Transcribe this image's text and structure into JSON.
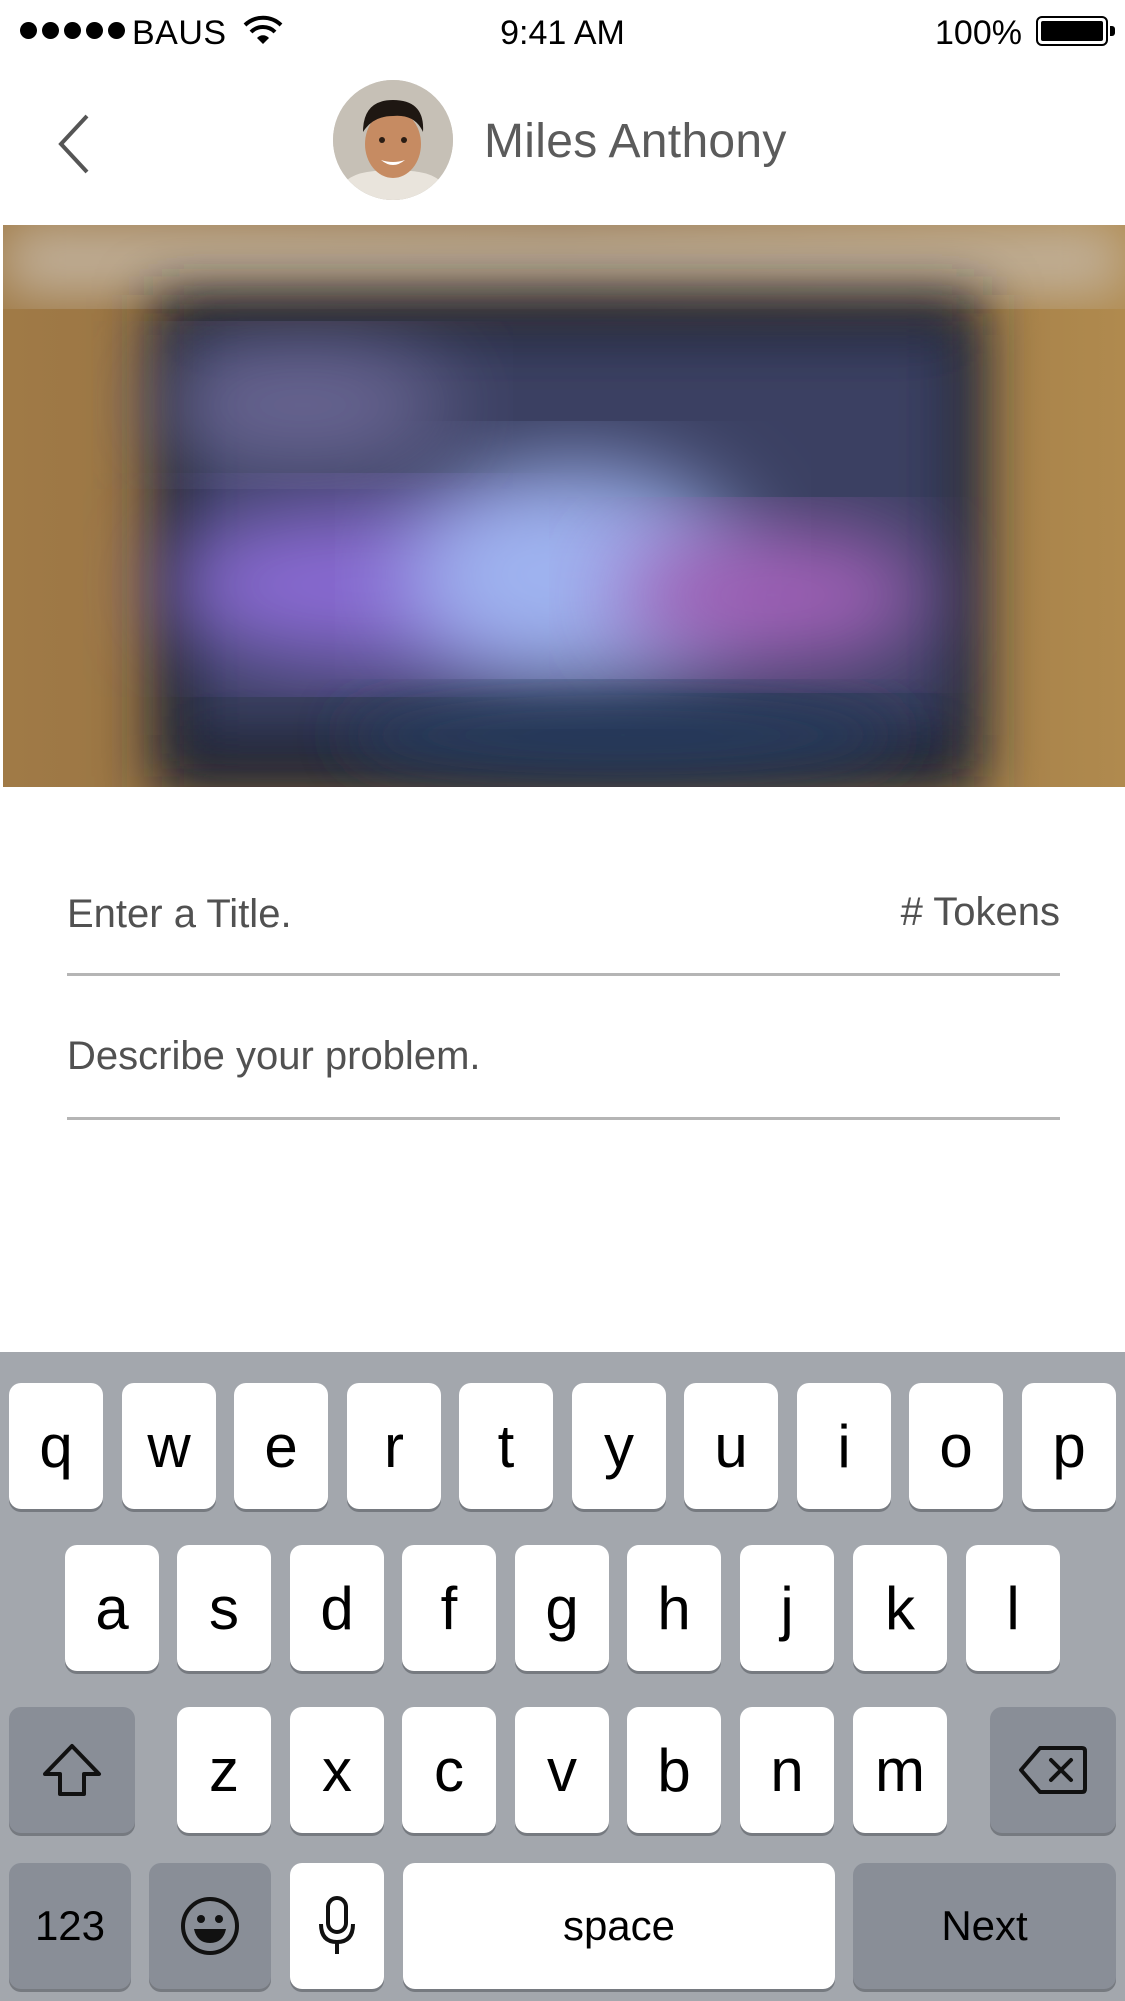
{
  "status_bar": {
    "carrier": "BAUS",
    "time": "9:41 AM",
    "battery": "100%",
    "icons": [
      "signal-dots-icon",
      "wifi-icon",
      "battery-icon"
    ]
  },
  "header": {
    "back_icon": "chevron-left-icon",
    "name": "Miles Anthony"
  },
  "form": {
    "title_placeholder": "Enter a Title.",
    "tokens_label": "# Tokens",
    "description_placeholder": "Describe your problem."
  },
  "keyboard": {
    "row1": [
      "q",
      "w",
      "e",
      "r",
      "t",
      "y",
      "u",
      "i",
      "o",
      "p"
    ],
    "row2": [
      "a",
      "s",
      "d",
      "f",
      "g",
      "h",
      "j",
      "k",
      "l"
    ],
    "row3": [
      "z",
      "x",
      "c",
      "v",
      "b",
      "n",
      "m"
    ],
    "numbers_key": "123",
    "space_key": "space",
    "next_key": "Next",
    "icons": [
      "shift-icon",
      "delete-icon",
      "emoji-icon",
      "microphone-icon"
    ]
  },
  "colors": {
    "keyboard_bg": "#a3a7ad",
    "key_light": "#ffffff",
    "key_dark": "#898e97",
    "divider": "#b5b5b5"
  }
}
